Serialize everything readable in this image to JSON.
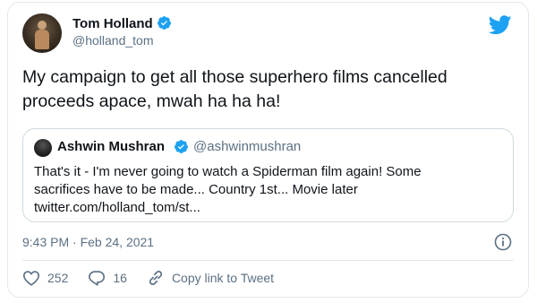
{
  "tweet": {
    "author_name": "Tom Holland",
    "author_handle": "@holland_tom",
    "text_line1": "My campaign to get all those superhero films cancelled",
    "text_line2": "proceeds apace, mwah ha ha ha!",
    "timestamp": "9:43 PM · Feb 24, 2021",
    "brand_color": "#1da1f2",
    "icons": [
      "verified-badge-icon",
      "twitter-bird-icon",
      "info-icon",
      "heart-icon",
      "reply-icon",
      "link-icon"
    ]
  },
  "quoted_tweet": {
    "author_name": "Ashwin Mushran",
    "author_handle": "@ashwinmushran",
    "text_line1": "That's it - I'm never going to watch a Spiderman film again! Some",
    "text_line2": "sacrifices have to be made... Country 1st... Movie later",
    "text_line3": "twitter.com/holland_tom/st..."
  },
  "actions": {
    "likes": "252",
    "replies": "16",
    "copy_link_label": "Copy link to Tweet"
  }
}
